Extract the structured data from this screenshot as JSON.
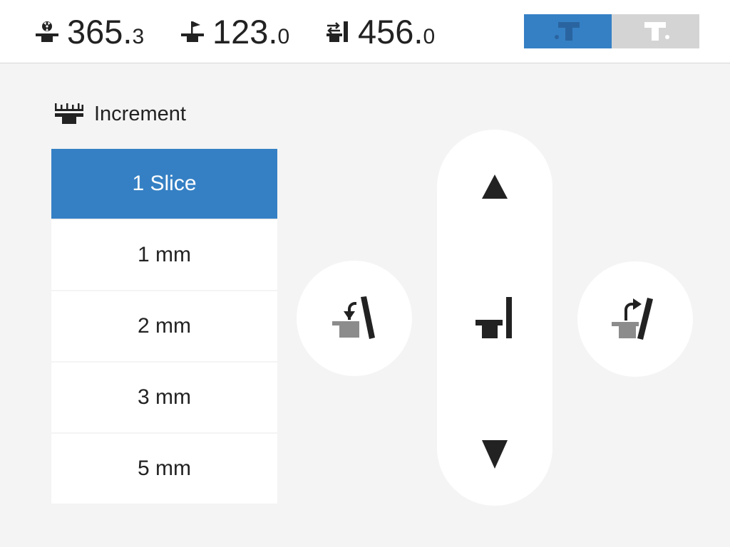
{
  "header": {
    "readouts": [
      {
        "icon": "radiation-table-icon",
        "integer": "365.",
        "decimal": "3"
      },
      {
        "icon": "table-tilt-icon",
        "integer": "123.",
        "decimal": "0"
      },
      {
        "icon": "table-horizontal-move-icon",
        "integer": "456.",
        "decimal": "0"
      }
    ],
    "mode_toggle": {
      "options": [
        {
          "icon": "table-mode-left-icon",
          "active": true
        },
        {
          "icon": "table-mode-right-icon",
          "active": false
        }
      ]
    }
  },
  "increment": {
    "icon": "ruler-table-icon",
    "label": "Increment",
    "options": [
      "1 Slice",
      "1 mm",
      "2 mm",
      "3 mm",
      "5 mm"
    ],
    "selected": "1 Slice"
  },
  "controls": {
    "tilt_left": {
      "icon": "tilt-counterclockwise-icon"
    },
    "tilt_right": {
      "icon": "tilt-clockwise-icon"
    },
    "move_up": {
      "icon": "arrow-up-icon"
    },
    "home": {
      "icon": "table-home-icon"
    },
    "move_down": {
      "icon": "arrow-down-icon"
    }
  },
  "colors": {
    "accent": "#3580c4",
    "background": "#f4f4f4",
    "panel": "#ffffff",
    "inactive": "#d4d4d4",
    "text": "#222222"
  }
}
